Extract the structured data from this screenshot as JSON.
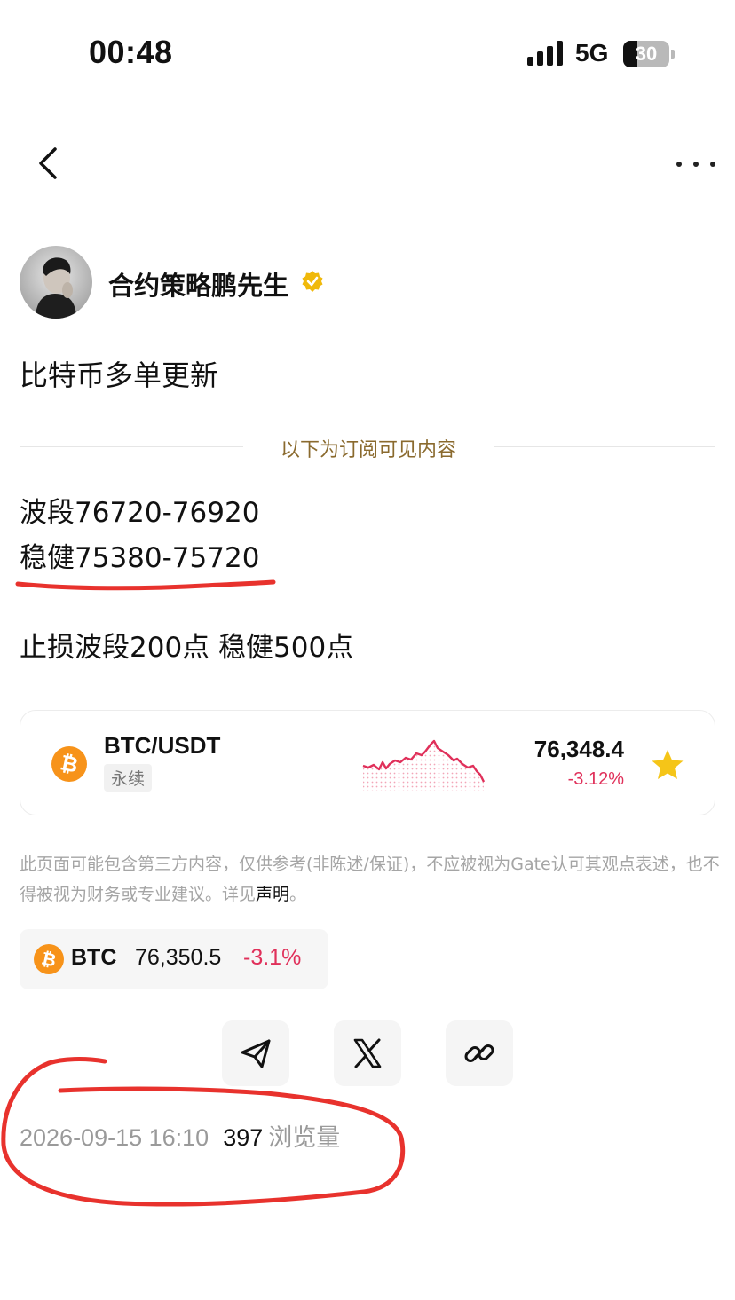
{
  "status_bar": {
    "time": "00:48",
    "network": "5G",
    "battery": "30",
    "battery_level": 0.3
  },
  "nav": {
    "back_icon": "chevron-left-icon",
    "more_icon": "more-horizontal-icon"
  },
  "author": {
    "name": "合约策略鹏先生",
    "verified_color": "#f0b90b"
  },
  "post": {
    "title": "比特币多单更新",
    "subscribe_divider": "以下为订阅可见内容",
    "lines": [
      "波段76720-76920",
      "稳健75380-75720",
      "止损波段200点 稳健500点"
    ]
  },
  "ticker": {
    "pair": "BTC/USDT",
    "type": "永续",
    "price": "76,348.4",
    "change": "-3.12%",
    "star_color": "#f5c518"
  },
  "disclaimer": {
    "text": "此页面可能包含第三方内容，仅供参考(非陈述/保证)，不应被视为Gate认可其观点表述，也不得被视为财务或专业建议。详见",
    "link": "声明",
    "end": "。"
  },
  "coin_chip": {
    "symbol": "BTC",
    "price": "76,350.5",
    "change": "-3.1%"
  },
  "share": {
    "icons": [
      "send-icon",
      "x-icon",
      "link-icon"
    ]
  },
  "meta": {
    "date": "2026-09-15 16:10",
    "views": "397",
    "views_label": "浏览量"
  },
  "colors": {
    "down": "#e0305a",
    "btc": "#f7931a",
    "annotation": "#e8322d",
    "divider_text": "#8a6a2e"
  }
}
